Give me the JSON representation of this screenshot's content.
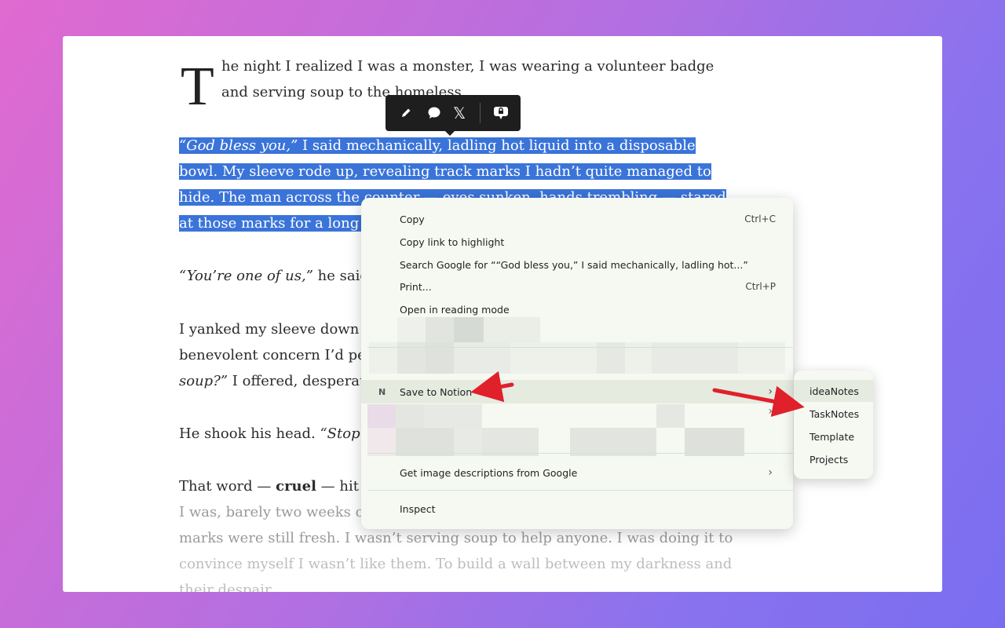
{
  "article": {
    "dropcap": "T",
    "p1": "he night I realized I was a monster, I was wearing a volunteer badge and serving soup to the homeless.",
    "p2_italic": "“God bless you,”",
    "p2_rest": " I said mechanically, ladling hot liquid into a disposable bowl. My sleeve rode up, revealing track marks I hadn’t quite managed to hide. The man across the counter — eyes sunken, hands trembling — stared at those marks for a long moment.",
    "p3_italic": "“You’re one of us,”",
    "p3_rest": " he said s",
    "p4_a": "I yanked my sleeve down",
    "p4_b": "benevolent concern I’d pe",
    "p4_c_italic": "soup?”",
    "p4_c_rest": " I offered, desperat",
    "p5_a": "He shook his head. ",
    "p5_italic": "“Stop p",
    "p6_a": "That word — ",
    "p6_bold": "cruel",
    "p6_b": " — hit m",
    "p6_line2": "I was, barely two weeks cl",
    "p6_line3": "marks were still fresh. I wasn’t serving soup to help anyone. I was doing it to",
    "p6_line4": "convince myself I wasn’t like them. To build a wall between my darkness and",
    "p6_line5": "their despair."
  },
  "toolbar": {
    "highlight_icon": "pencil-icon",
    "comment_icon": "speech-bubble-icon",
    "share_x_icon": "x-logo-icon",
    "note_icon": "note-bubble-icon",
    "x_glyph": "𝕏"
  },
  "context_menu": {
    "copy": "Copy",
    "copy_shortcut": "Ctrl+C",
    "copy_link": "Copy link to highlight",
    "search_google": "Search Google for ““God bless you,” I said mechanically, ladling hot...”",
    "print": "Print...",
    "print_shortcut": "Ctrl+P",
    "reading_mode": "Open in reading mode",
    "save_to_notion": "Save to Notion",
    "image_descriptions": "Get image descriptions from Google",
    "inspect": "Inspect",
    "arrow": "›"
  },
  "submenu": {
    "items": [
      "ideaNotes",
      "TaskNotes",
      "Template",
      "Projects"
    ]
  },
  "colors": {
    "selection": "#3a74d9",
    "menu_bg": "#f6f9f2",
    "arrow_red": "#e0202a"
  }
}
